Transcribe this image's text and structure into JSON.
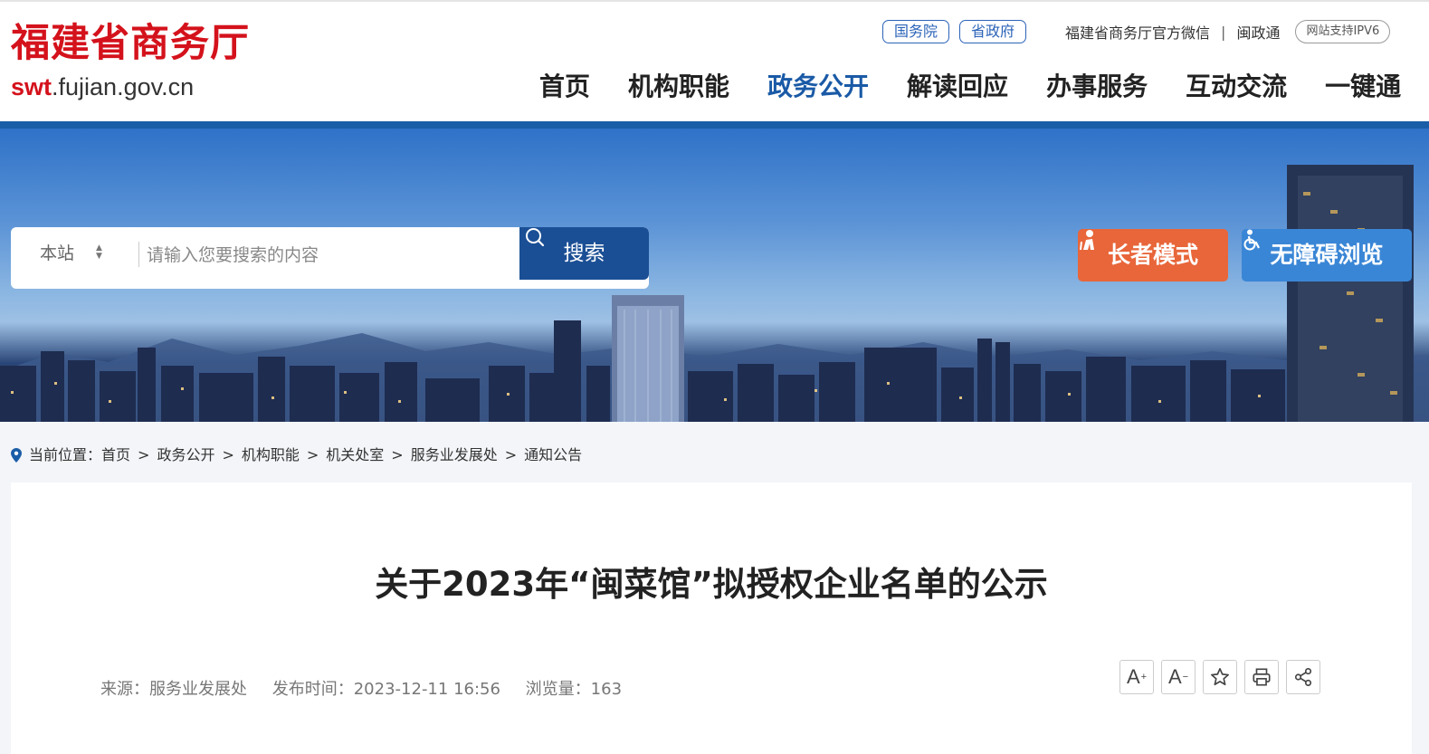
{
  "header": {
    "logo_cn": "福建省商务厅",
    "logo_url_bold": "swt",
    "logo_url_rest": ".fujian.gov.cn",
    "top_links": {
      "pill1": "国务院",
      "pill2": "省政府",
      "wechat": "福建省商务厅官方微信",
      "separator": "|",
      "minzhengtong": "闽政通",
      "ipv6": "网站支持IPV6"
    },
    "nav": [
      "首页",
      "机构职能",
      "政务公开",
      "解读回应",
      "办事服务",
      "互动交流",
      "一键通"
    ],
    "active_nav": "政务公开",
    "brand_color": "#d4121c",
    "accent_color": "#1b5ea8"
  },
  "search": {
    "scope": "本站",
    "placeholder": "请输入您要搜索的内容",
    "button_label": "搜索"
  },
  "modes": {
    "elder": "长者模式",
    "accessible": "无障碍浏览",
    "elder_color": "#e8663a",
    "accessible_color": "#3a86d6"
  },
  "breadcrumb": {
    "label": "当前位置：",
    "items": [
      "首页",
      "政务公开",
      "机构职能",
      "机关处室",
      "服务业发展处",
      "通知公告"
    ],
    "separator": ">"
  },
  "article": {
    "title": "关于2023年“闽菜馆”拟授权企业名单的公示",
    "source": "来源：服务业发展处",
    "publish_time": "发布时间：2023-12-11 16:56",
    "views": "浏览量：163",
    "tools": {
      "font_increase": "A",
      "font_increase_sup": "+",
      "font_decrease": "A",
      "font_decrease_sup": "−",
      "icons": [
        "star-icon",
        "print-icon",
        "share-icon"
      ]
    }
  }
}
